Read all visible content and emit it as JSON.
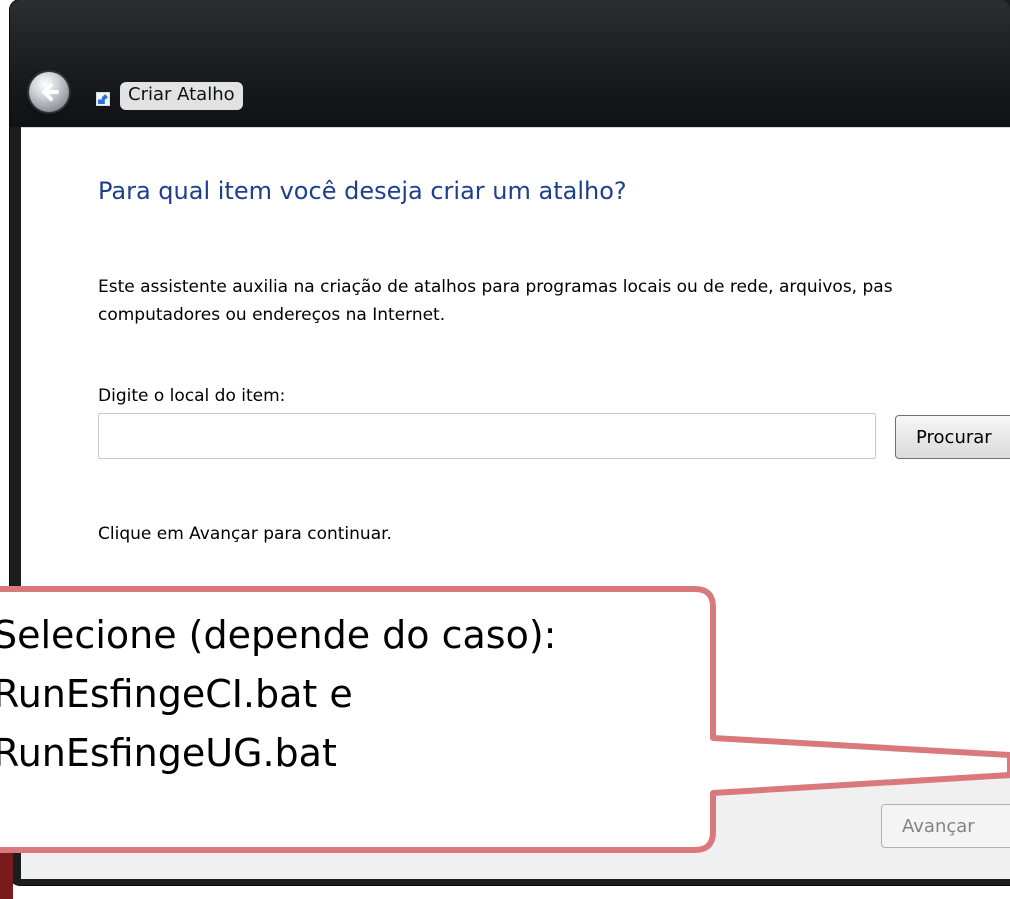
{
  "window": {
    "title": "Criar Atalho"
  },
  "dialog": {
    "heading": "Para qual item você deseja criar um atalho?",
    "description_line_1": "Este assistente auxilia na criação de atalhos para programas locais ou de rede, arquivos, pas",
    "description_line_2": "computadores ou endereços na Internet.",
    "location_label": "Digite o local do item:",
    "location_value": "",
    "browse_label": "Procurar",
    "continue_text": "Clique em Avançar para continuar.",
    "next_label": "Avançar"
  },
  "callout": {
    "line_1": "Selecione (depende do caso):",
    "line_2": "RunEsfingeCI.bat e",
    "line_3": "RunEsfingeUG.bat"
  },
  "colors": {
    "heading": "#1e3f8e",
    "callout_border": "#d9797d",
    "title_bar": "#16181b"
  },
  "icons": {
    "back": "back-arrow-icon",
    "shortcut": "shortcut-icon"
  }
}
